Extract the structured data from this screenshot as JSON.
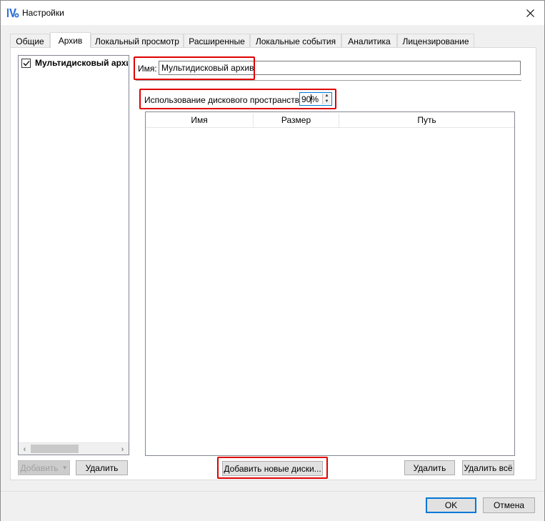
{
  "window": {
    "title": "Настройки"
  },
  "tabs": [
    {
      "label": "Общие"
    },
    {
      "label": "Архив"
    },
    {
      "label": "Локальный просмотр"
    },
    {
      "label": "Расширенные"
    },
    {
      "label": "Локальные события"
    },
    {
      "label": "Аналитика"
    },
    {
      "label": "Лицензирование"
    }
  ],
  "active_tab": "Архив",
  "archive_list": {
    "items": [
      {
        "label": "Мультидисковый архив",
        "checked": true
      }
    ],
    "add_button": "Добавить",
    "delete_button": "Удалить"
  },
  "archive_form": {
    "name_label": "Имя:",
    "name_value": "Мультидисковый архив",
    "disk_usage_label": "Использование дискового пространства:",
    "disk_usage_value": "90%",
    "table_columns": [
      "Имя",
      "Размер",
      "Путь"
    ],
    "add_disks_button": "Добавить новые диски...",
    "delete_button": "Удалить",
    "delete_all_button": "Удалить всё"
  },
  "dialog_buttons": {
    "ok": "OK",
    "cancel": "Отмена"
  },
  "colors": {
    "highlight_red": "#e00000",
    "focus_blue": "#0078d7",
    "window_bg": "#f0f0f0"
  }
}
